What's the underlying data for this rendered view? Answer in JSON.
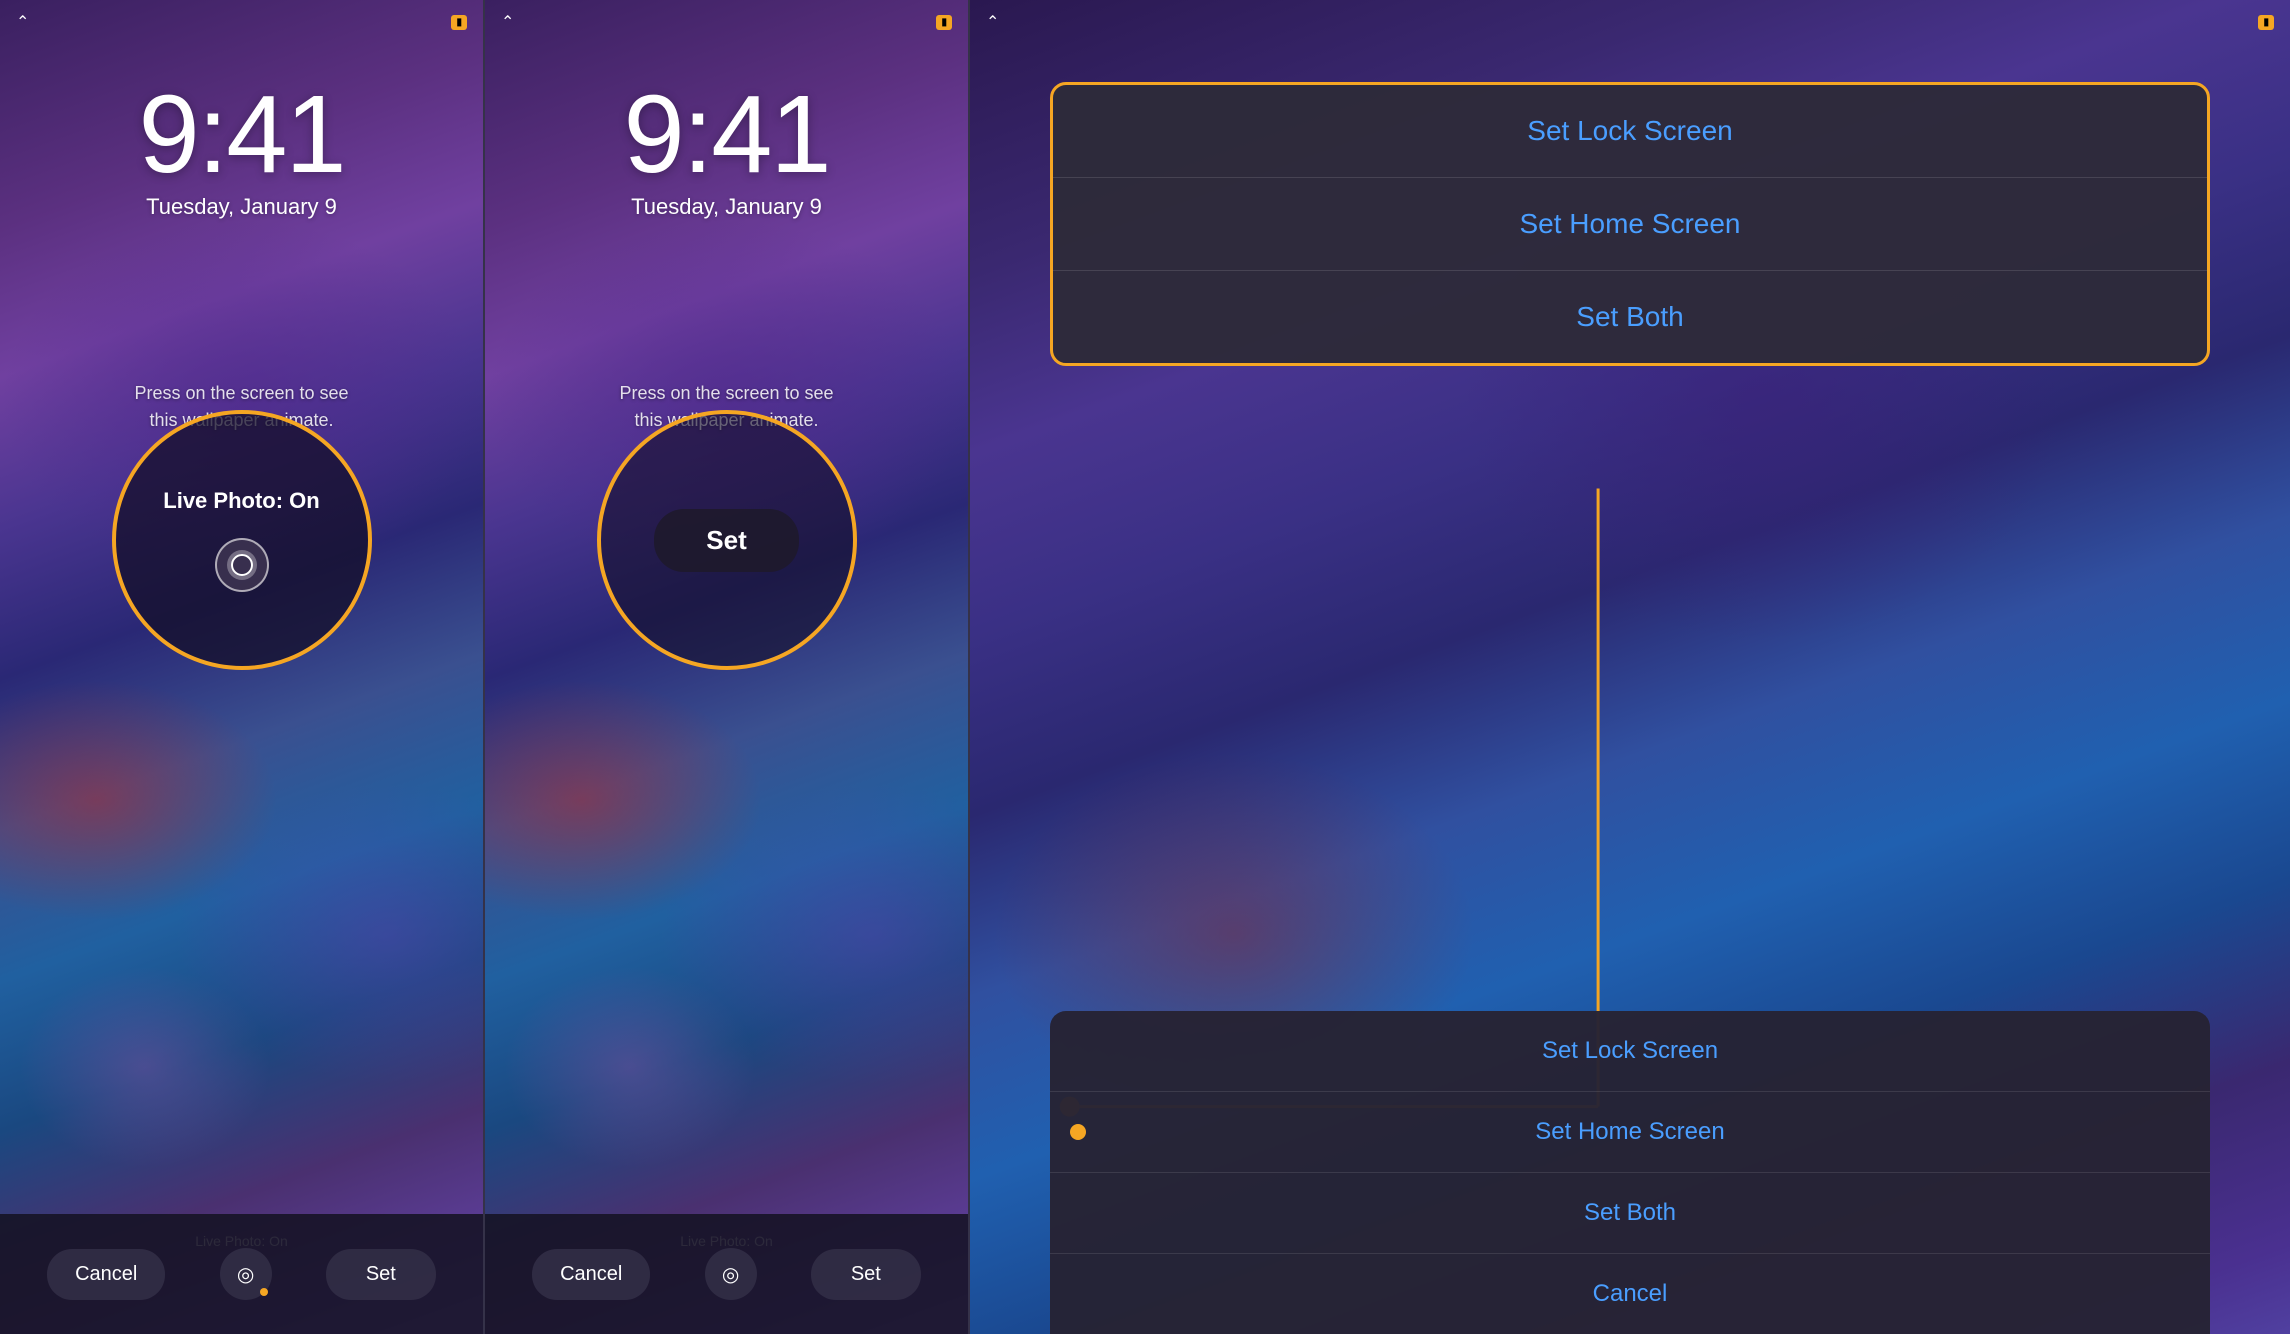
{
  "phone1": {
    "time": "9:41",
    "date": "Tuesday, January 9",
    "wallpaper_text": "Press on the screen to see\nthis wallpaper animate.",
    "live_photo_label": "Live Photo: On",
    "bottom_label": "Live Photo: On",
    "cancel_btn": "Cancel",
    "set_btn": "Set"
  },
  "phone2": {
    "time": "9:41",
    "date": "Tuesday, January 9",
    "wallpaper_text": "Press on the screen to see\nthis wallpaper animate.",
    "set_button_label": "Set",
    "bottom_label": "Live Photo: On",
    "cancel_btn": "Cancel",
    "set_btn": "Set"
  },
  "action_sheet_top": {
    "items": [
      {
        "label": "Set Lock Screen"
      },
      {
        "label": "Set Home Screen"
      },
      {
        "label": "Set Both"
      }
    ]
  },
  "action_sheet_bottom": {
    "items": [
      {
        "label": "Set Lock Screen",
        "has_dot": false
      },
      {
        "label": "Set Home Screen",
        "has_dot": true
      },
      {
        "label": "Set Both",
        "has_dot": false
      },
      {
        "label": "Cancel",
        "has_dot": false
      }
    ]
  }
}
